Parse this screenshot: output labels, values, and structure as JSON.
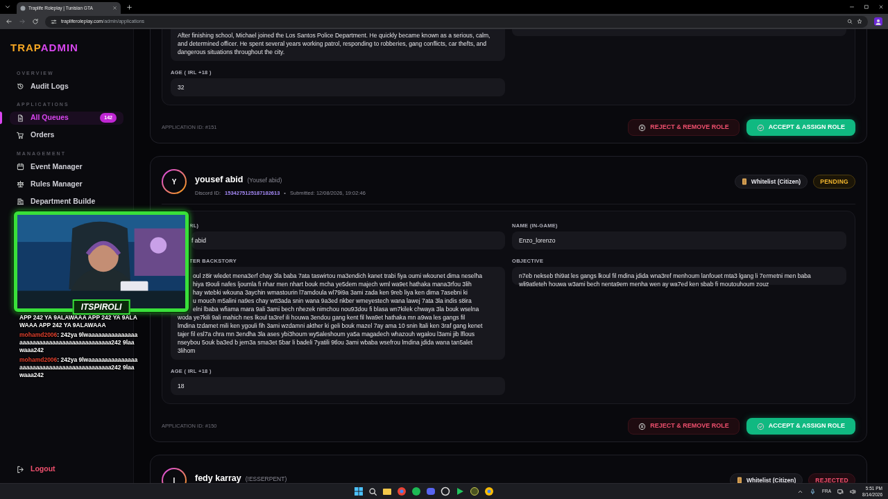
{
  "browser": {
    "tab_title": "Traplife Roleplay | Tunisian GTA",
    "url_host": "trapliferoleplay.com",
    "url_path": "/admin/applications"
  },
  "sidebar": {
    "logo_first": "TRAP",
    "logo_second": "ADMIN",
    "sections": [
      {
        "title": "OVERVIEW",
        "items": [
          {
            "label": "Audit Logs",
            "kind": "history",
            "selected": false
          }
        ]
      },
      {
        "title": "APPLICATIONS",
        "items": [
          {
            "label": "All Queues",
            "kind": "file",
            "selected": true,
            "count": "142"
          },
          {
            "label": "Orders",
            "kind": "cart",
            "selected": false
          }
        ]
      },
      {
        "title": "MANAGEMENT",
        "items": [
          {
            "label": "Event Manager",
            "kind": "calendar",
            "selected": false
          },
          {
            "label": "Rules Manager",
            "kind": "scale",
            "selected": false
          },
          {
            "label": "Department Builde",
            "kind": "building",
            "selected": false
          }
        ]
      }
    ],
    "logout": "Logout"
  },
  "applications": [
    {
      "left": [
        {
          "kind": "text",
          "value": "After finishing school, Michael joined the Los Santos Police Department. He quickly became known as a serious, calm, and determined officer. He spent several years working patrol, responding to robberies, gang conflicts, car thefts, and dangerous situations throughout the city."
        },
        {
          "kind": "text",
          "label": "AGE ( IRL +18 )",
          "value": "32"
        }
      ],
      "right": [
        {
          "kind": "field_end"
        }
      ],
      "app_id": "APPLICATION ID: #151",
      "actions": [
        {
          "kind": "reject",
          "label": "REJECT & REMOVE ROLE"
        },
        {
          "kind": "accept",
          "label": "ACCEPT & ASSIGN ROLE"
        }
      ]
    },
    {
      "header": {
        "initial": "Y",
        "name": "yousef abid",
        "alias": "(Yousef abid)",
        "discord_label": "Discord ID:",
        "discord_id": "1534275125187182613",
        "separator": "•",
        "submitted": "Submitted: 12/08/2026, 19:02:46",
        "type": "Whitelist (Citizen)",
        "status": {
          "kind": "pending",
          "text": "PENDING"
        }
      },
      "left": [
        {
          "kind": "text",
          "cut": true,
          "label": "RL)",
          "value": "f  abid"
        },
        {
          "kind": "lines",
          "cut": true,
          "label": "TER BACKSTORY",
          "lines": [
            {
              "cut": true,
              "text": "oul z8ir wledet mena3erf chay 3la baba 7ata taswirtou ma3endich kanet trabi fiya oumi wkounet dima neselha"
            },
            {
              "cut": true,
              "text": "hiya t9ouli nafes ljoumla  fi nhar men nhart bouk mcha ye5dem majech wml wa9et hathaka mana3rfou 3lih"
            },
            {
              "cut": true,
              "text": "hay wtebki wkouna 3aychin wmastourin l7amdoula  wl79i9a  3ami zada  ken  9reb liya ken dima 7asebni ki"
            },
            {
              "cut": true,
              "text": "u mouch m5alini na9es chay wtt3ada snin wana 9a3ed nkber wmeyestech wana lawej 7ata 3la indis s8ira"
            },
            {
              "cut": true,
              "text": "elni lbaba wfiama mara  9ali 3ami bech nhezek  nimchou nou93dou fi blasa wn7kilek chwaya 3la bouk wselna"
            },
            {
              "cut": false,
              "text": "woda ye7kili 9ali  mahich nes lkoul ta3ref ili houwa 3endou gang kent fil lwa9et hathaka  mn  a9wa les gangs fil"
            },
            {
              "cut": false,
              "text": "lmdina tzdamet  mili ken ygouli fih 3ami wzdamni akther ki geli bouk mazel 7ay ama 10 snin ltali ken 3raf gang kenet"
            },
            {
              "cut": false,
              "text": "tajer fil esl7a  chra mn 3endha 3la ases ybi3houm wy5aleshoum  ya5a magadech whazouh wgalou l3ami jib lflous"
            },
            {
              "cut": false,
              "text": "nseybou 5ouk  ba3ed b jem3a sma3et 5bar li badeli 7yatili 9tlou 3ami wbaba wsefrou lmdina jdida wana tan5alet"
            },
            {
              "cut": false,
              "text": "3lihom"
            }
          ]
        },
        {
          "kind": "text",
          "label": "AGE ( IRL +18 )",
          "value": "18"
        }
      ],
      "right": [
        {
          "kind": "text",
          "label": "NAME (IN-GAME)",
          "value": "Enzo_lorenzo"
        },
        {
          "kind": "text",
          "label": "OBJECTIVE",
          "value": "n7eb nekseb thi9at les gangs lkoul  fil mdina jdida wna3ref menhoum lanfouet mta3  lgang li 7ermetni men baba wli9atleteh houwa w3ami  bech nenta9em menha wen ay wa7ed ken sbab fi moutouhoum zouz"
        }
      ],
      "app_id": "APPLICATION ID: #150",
      "actions": [
        {
          "kind": "reject",
          "label": "REJECT & REMOVE ROLE"
        },
        {
          "kind": "accept",
          "label": "ACCEPT & ASSIGN ROLE"
        }
      ]
    },
    {
      "header": {
        "initial": "I",
        "name": "fedy karray",
        "alias": "(!ESSERPENT)",
        "type": "Whitelist (Citizen)",
        "status": {
          "kind": "rejected",
          "text": "REJECTED"
        }
      }
    }
  ],
  "stream_overlay": {
    "streamer": "ITSPIROLI",
    "chat": [
      {
        "kind": "message",
        "text": "APP 242 YA 9ALAWAAA APP 242 YA 9ALAWAAA APP 242 YA 9ALAWAAA"
      },
      {
        "kind": "user",
        "user": "mohamd2006",
        "text": ": 242ya 9lwaaaaaaaaaaaaaaaaaaaaaaaaaaaaaaaaaaaaaaaaaaa242 9laawaaa242"
      },
      {
        "kind": "user",
        "user": "mohamd2006",
        "text": ": 242ya 9lwaaaaaaaaaaaaaaaaaaaaaaaaaaaaaaaaaaaaaaaaaaa242 9laawaaa242"
      }
    ]
  },
  "taskbar": {
    "language": "FRA",
    "time": "5:51 PM",
    "date": "8/14/2026"
  }
}
